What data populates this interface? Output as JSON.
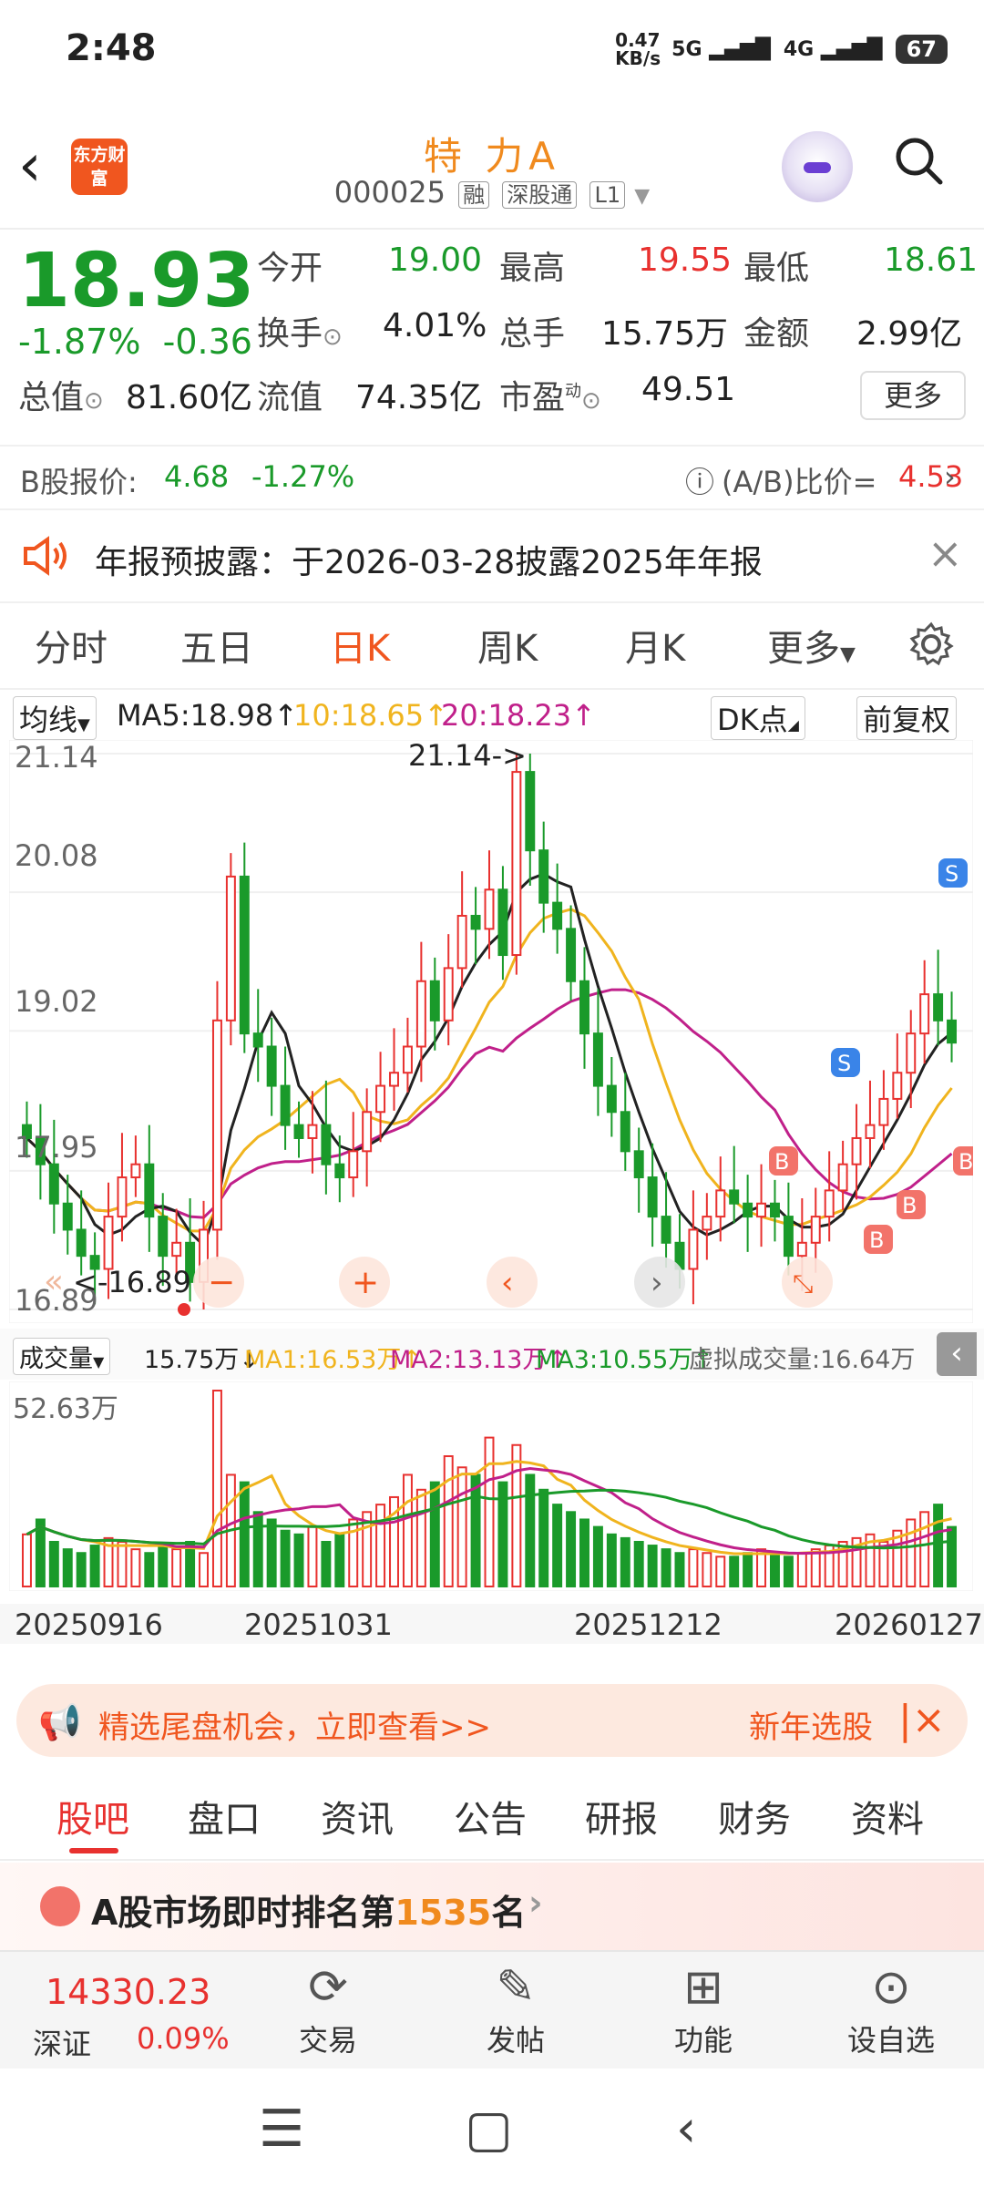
{
  "status": {
    "time": "2:48",
    "net_speed": "0.47 KB/s",
    "net1": "5G",
    "net2": "4G",
    "battery": "67"
  },
  "header": {
    "logo": "东方财富",
    "name": "特 力A",
    "code": "000025",
    "tags": [
      "融",
      "深股通",
      "L1"
    ]
  },
  "quote": {
    "price": "18.93",
    "change_pct": "-1.87%",
    "change_abs": "-0.36",
    "open_label": "今开",
    "open": "19.00",
    "high_label": "最高",
    "high": "19.55",
    "low_label": "最低",
    "low": "18.61",
    "turnover_label": "换手",
    "turnover": "4.01%",
    "volume_label": "总手",
    "volume": "15.75万",
    "amount_label": "金额",
    "amount": "2.99亿",
    "mktcap_label": "总值",
    "mktcap": "81.60亿",
    "float_label": "流值",
    "float": "74.35亿",
    "pe_label": "市盈",
    "pe_sup": "动",
    "pe": "49.51",
    "more": "更多"
  },
  "bshare": {
    "label": "B股报价:",
    "price": "4.68",
    "change": "-1.27%",
    "ratio_label": "(A/B)比价=",
    "ratio": "4.53"
  },
  "notice": {
    "text": "年报预披露：于2026-03-28披露2025年年报"
  },
  "ktabs": [
    "分时",
    "五日",
    "日K",
    "周K",
    "月K",
    "更多"
  ],
  "ma": {
    "selector": "均线",
    "ma5": "MA5:18.98",
    "ma10": "10:18.65",
    "ma20": "20:18.23",
    "dk": "DK点",
    "adjust": "前复权"
  },
  "chart_axis": {
    "y1": "21.14",
    "y2": "20.08",
    "y3": "19.02",
    "y4": "17.95",
    "y5": "16.89",
    "max_note": "21.14->",
    "min_note": "<-16.89"
  },
  "volume": {
    "selector": "成交量",
    "vol": "15.75万",
    "ma1": "MA1:16.53万",
    "ma2": "MA2:13.13万",
    "ma3": "MA3:10.55万",
    "virtual": "虚拟成交量:16.64万",
    "max": "52.63万"
  },
  "dates": [
    "20250916",
    "20251031",
    "20251212",
    "20260127"
  ],
  "promo": {
    "text": "精选尾盘机会，立即查看>>",
    "right": "新年选股"
  },
  "btabs": [
    "股吧",
    "盘口",
    "资讯",
    "公告",
    "研报",
    "财务",
    "资料"
  ],
  "ranking": {
    "prefix": "A股市场即时排名第",
    "rank": "1535",
    "suffix": "名"
  },
  "bottom": {
    "index_value": "14330.23",
    "index_name": "深证",
    "index_change": "0.09%",
    "trade": "交易",
    "post": "发帖",
    "func": "功能",
    "watch": "设自选"
  },
  "chart_data": {
    "type": "candlestick",
    "y_range": [
      16.89,
      21.14
    ],
    "y_ticks": [
      21.14,
      20.08,
      19.02,
      17.95,
      16.89
    ],
    "x_ticks": [
      "20250916",
      "20251031",
      "20251212",
      "20260127"
    ],
    "closes": [
      18.2,
      18.0,
      17.7,
      17.5,
      17.3,
      17.2,
      17.6,
      17.9,
      18.0,
      17.6,
      17.3,
      17.4,
      17.1,
      17.5,
      19.1,
      20.2,
      19.0,
      18.9,
      18.6,
      18.3,
      18.2,
      18.3,
      18.0,
      17.9,
      18.1,
      18.4,
      18.6,
      18.7,
      18.9,
      19.4,
      19.1,
      19.5,
      19.9,
      19.8,
      20.1,
      19.6,
      21.0,
      20.4,
      20.0,
      19.8,
      19.4,
      19.0,
      18.6,
      18.4,
      18.1,
      17.9,
      17.6,
      17.4,
      17.2,
      17.5,
      17.6,
      17.8,
      17.7,
      17.6,
      17.7,
      17.6,
      17.3,
      17.4,
      17.6,
      17.8,
      18.0,
      18.2,
      18.3,
      18.5,
      18.7,
      19.0,
      19.3,
      19.1,
      18.93
    ],
    "volumes_wan": [
      14,
      18,
      12,
      10,
      9,
      11,
      13,
      12,
      10,
      9,
      11,
      10,
      12,
      9,
      52.63,
      30,
      28,
      20,
      18,
      15,
      14,
      16,
      12,
      14,
      18,
      20,
      22,
      24,
      30,
      26,
      28,
      35,
      32,
      30,
      40,
      28,
      38,
      30,
      26,
      22,
      20,
      18,
      16,
      14,
      13,
      12,
      11,
      10,
      9,
      10,
      9,
      8,
      8,
      9,
      10,
      9,
      8,
      9,
      10,
      11,
      12,
      13,
      14,
      12,
      15,
      18,
      20,
      22,
      16
    ]
  }
}
